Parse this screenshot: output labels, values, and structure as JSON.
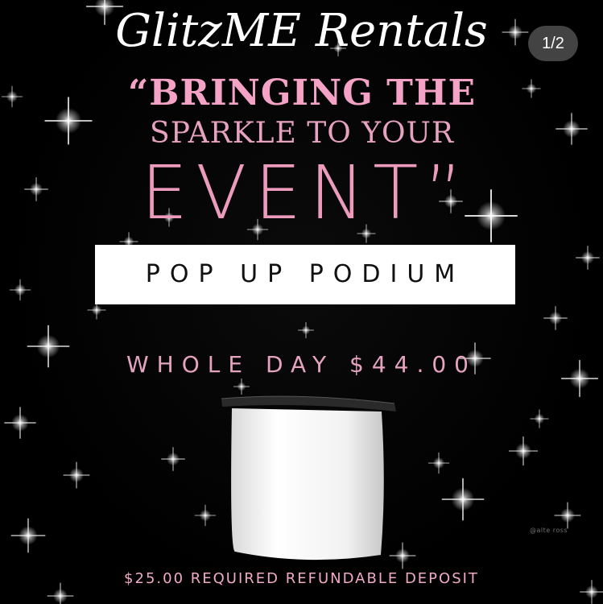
{
  "brand": {
    "title": "GlitzME Rentals"
  },
  "carousel": {
    "counter": "1/2"
  },
  "tagline": {
    "line1": "“BRINGING THE",
    "line2": "SPARKLE TO YOUR",
    "line3": "EVENT”"
  },
  "product": {
    "name": "POP UP PODIUM",
    "price": "WHOLE DAY $44.00",
    "deposit": "$25.00 REQUIRED REFUNDABLE DEPOSIT"
  },
  "watermark": {
    "text": "@alte  ross"
  },
  "colors": {
    "background": "#000000",
    "pink": "#f4a3c6",
    "banner": "#ffffff",
    "podium_top": "#2a2a2a",
    "podium_body": "#f4f4f4"
  },
  "icons": {
    "image": "podium-image",
    "decoration": "sparkle-icon"
  }
}
